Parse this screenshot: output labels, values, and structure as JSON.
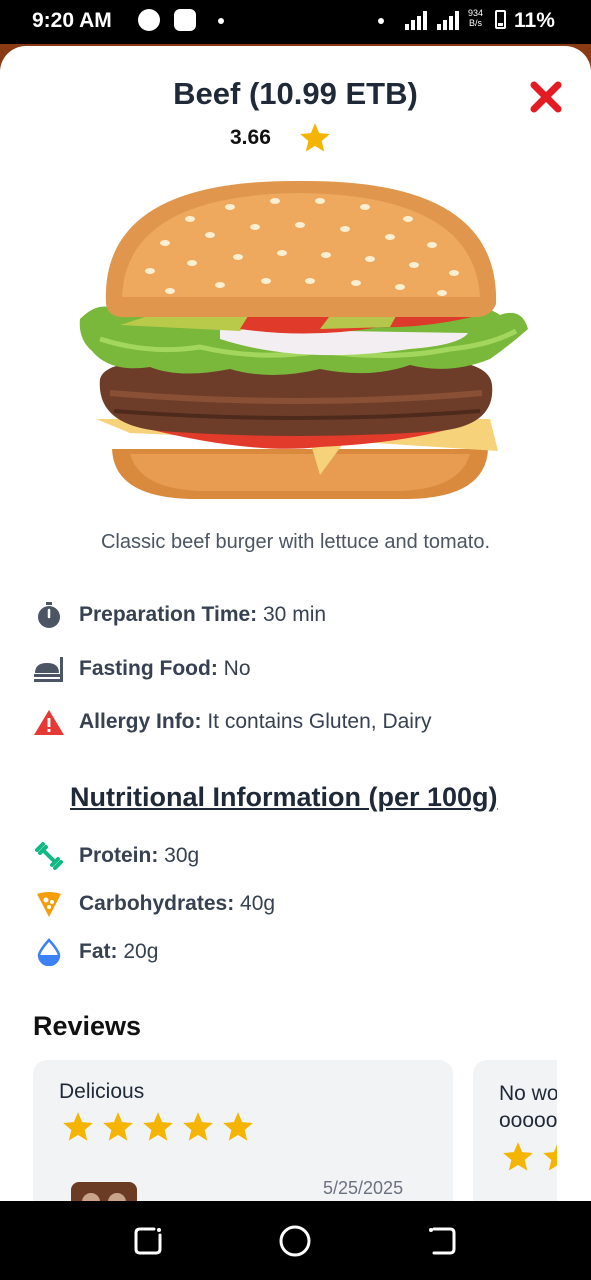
{
  "status_bar": {
    "time": "9:20 AM",
    "network_speed_value": "934",
    "network_speed_unit": "B/s",
    "battery": "11%"
  },
  "dish": {
    "title": "Beef (10.99 ETB)",
    "rating": "3.66",
    "description": "Classic beef burger with lettuce and tomato."
  },
  "details": [
    {
      "icon": "stopwatch-icon",
      "label": "Preparation Time:",
      "value": " 30 min"
    },
    {
      "icon": "food-tray-icon",
      "label": "Fasting Food:",
      "value": " No"
    },
    {
      "icon": "warning-icon",
      "label": "Allergy Info:",
      "value": " It contains Gluten, Dairy"
    }
  ],
  "nutrition": {
    "heading": "Nutritional Information (per 100g)",
    "items": [
      {
        "icon": "dumbbell-icon",
        "label": "Protein:",
        "value": " 30g"
      },
      {
        "icon": "pizza-slice-icon",
        "label": "Carbohydrates:",
        "value": " 40g"
      },
      {
        "icon": "drop-icon",
        "label": "Fat:",
        "value": " 20g"
      }
    ]
  },
  "reviews": {
    "heading": "Reviews",
    "items": [
      {
        "title": "Delicious",
        "stars": 5,
        "date": "5/25/2025"
      },
      {
        "title_line1": "No wo",
        "title_line2": "ooooo"
      }
    ]
  },
  "colors": {
    "star": "#f5b400",
    "close": "#e31b23",
    "warning": "#e53935",
    "dumbbell": "#10b981",
    "pizza": "#f59e0b",
    "drop": "#3b82f6"
  }
}
